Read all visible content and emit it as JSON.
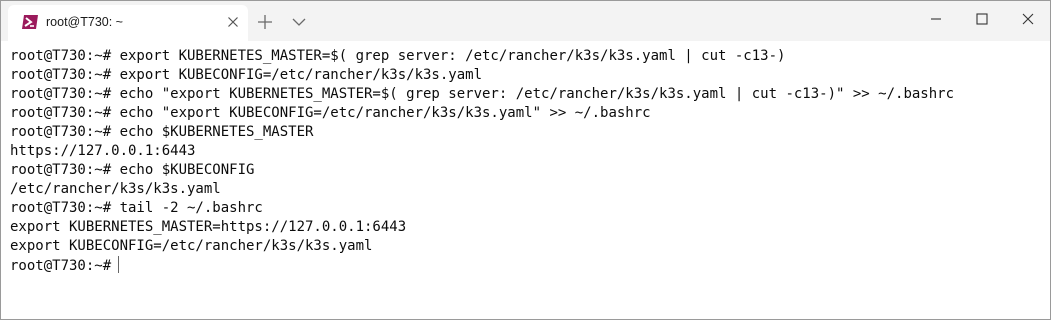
{
  "tab": {
    "title": "root@T730: ~",
    "icon": "powershell-icon"
  },
  "titlebar": {
    "new_tab_icon": "plus-icon",
    "dropdown_icon": "chevron-down-icon",
    "minimize_icon": "minimize-icon",
    "maximize_icon": "maximize-icon",
    "close_icon": "close-icon"
  },
  "colors": {
    "titlebar_bg": "#f3f3f3",
    "terminal_bg": "#ffffff",
    "terminal_fg": "#0c0c0c",
    "icon_bg": "#9b1a5c"
  },
  "terminal": {
    "lines": [
      "root@T730:~# export KUBERNETES_MASTER=$( grep server: /etc/rancher/k3s/k3s.yaml | cut -c13-)",
      "root@T730:~# export KUBECONFIG=/etc/rancher/k3s/k3s.yaml",
      "root@T730:~# echo \"export KUBERNETES_MASTER=$( grep server: /etc/rancher/k3s/k3s.yaml | cut -c13-)\" >> ~/.bashrc",
      "root@T730:~# echo \"export KUBECONFIG=/etc/rancher/k3s/k3s.yaml\" >> ~/.bashrc",
      "root@T730:~# echo $KUBERNETES_MASTER",
      "https://127.0.0.1:6443",
      "root@T730:~# echo $KUBECONFIG",
      "/etc/rancher/k3s/k3s.yaml",
      "root@T730:~# tail -2 ~/.bashrc",
      "export KUBERNETES_MASTER=https://127.0.0.1:6443",
      "export KUBECONFIG=/etc/rancher/k3s/k3s.yaml"
    ],
    "prompt": "root@T730:~#"
  }
}
